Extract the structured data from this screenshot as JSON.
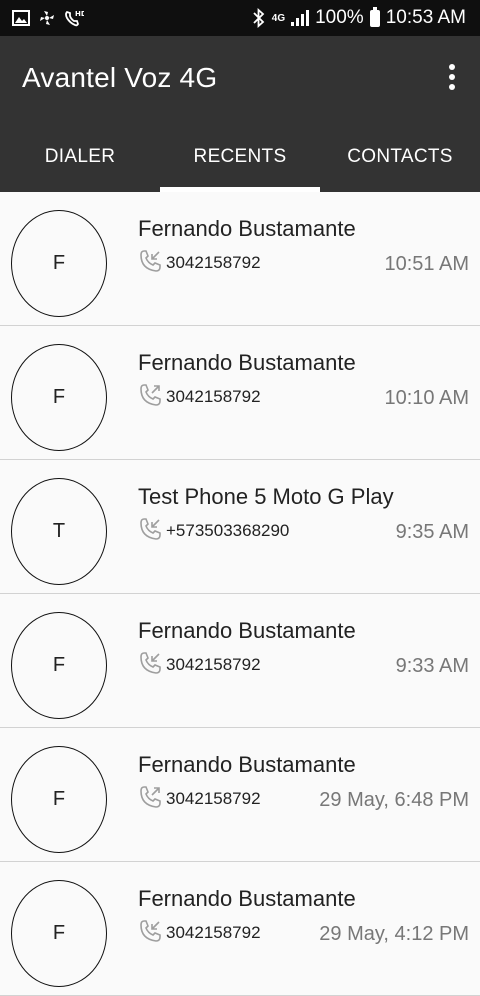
{
  "status_bar": {
    "icons": [
      "gallery-icon",
      "pinwheel-icon",
      "hd-call-icon",
      "bluetooth-icon",
      "signal-icon",
      "battery-icon"
    ],
    "network": "4G",
    "battery": "100%",
    "time": "10:53 AM"
  },
  "app_bar": {
    "title": "Avantel Voz 4G",
    "menu_icon": "more-vert-icon"
  },
  "tabs": [
    {
      "label": "DIALER",
      "active": false
    },
    {
      "label": "RECENTS",
      "active": true
    },
    {
      "label": "CONTACTS",
      "active": false
    }
  ],
  "colors": {
    "status_bar": "#0f0f0f",
    "app_bar": "#333333",
    "list_bg": "#fafafa",
    "divider": "#d2d2d2",
    "time_text": "#777777",
    "call_icon": "#9e9e9e"
  },
  "recents": [
    {
      "initial": "F",
      "name": "Fernando Bustamante",
      "number": "3042158792",
      "time": "10:51 AM",
      "direction": "incoming",
      "icon": "incoming-call-icon"
    },
    {
      "initial": "F",
      "name": "Fernando Bustamante",
      "number": "3042158792",
      "time": "10:10 AM",
      "direction": "outgoing",
      "icon": "outgoing-call-icon"
    },
    {
      "initial": "T",
      "name": "Test Phone 5 Moto G Play",
      "number": "+573503368290",
      "time": "9:35 AM",
      "direction": "incoming",
      "icon": "incoming-call-icon"
    },
    {
      "initial": "F",
      "name": "Fernando Bustamante",
      "number": "3042158792",
      "time": "9:33 AM",
      "direction": "incoming",
      "icon": "incoming-call-icon"
    },
    {
      "initial": "F",
      "name": "Fernando Bustamante",
      "number": "3042158792",
      "time": "29 May, 6:48 PM",
      "direction": "outgoing",
      "icon": "outgoing-call-icon"
    },
    {
      "initial": "F",
      "name": "Fernando Bustamante",
      "number": "3042158792",
      "time": "29 May, 4:12 PM",
      "direction": "incoming",
      "icon": "incoming-call-icon"
    }
  ]
}
